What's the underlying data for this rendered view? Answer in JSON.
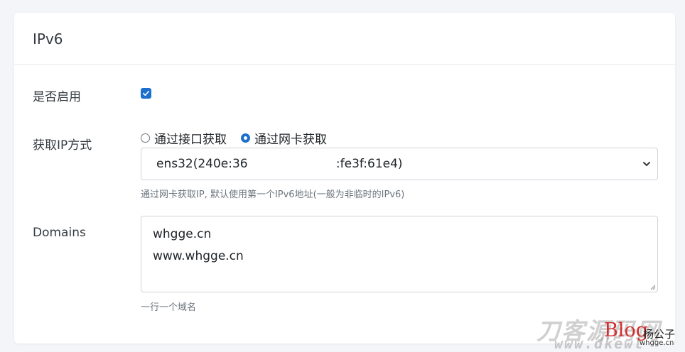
{
  "card": {
    "title": "IPv6"
  },
  "enable": {
    "label": "是否启用",
    "checked": true
  },
  "ip_method": {
    "label": "获取IP方式",
    "options": [
      "通过接口获取",
      "通过网卡获取"
    ],
    "selected": "通过网卡获取",
    "select_value": "ens32(240e:36                       :fe3f:61e4)",
    "help": "通过网卡获取IP, 默认使用第一个IPv6地址(一般为非临时的IPv6)"
  },
  "domains": {
    "label": "Domains",
    "lines": [
      "whgge.cn",
      "www.whgge.cn"
    ],
    "help": "一行一个域名"
  },
  "watermark": {
    "main": "刀客源码网",
    "sub": "www.dkewl",
    "blog": "Blog",
    "author": "杨公子",
    "site": "whgge.cn"
  },
  "colors": {
    "accent": "#1d6fce",
    "background": "#f4f5f9",
    "card": "#ffffff",
    "watermark_blog": "#d32f2f"
  },
  "icons": {
    "checkbox": "check-icon",
    "select": "chevron-down-icon",
    "textarea": "resize-handle-icon"
  }
}
